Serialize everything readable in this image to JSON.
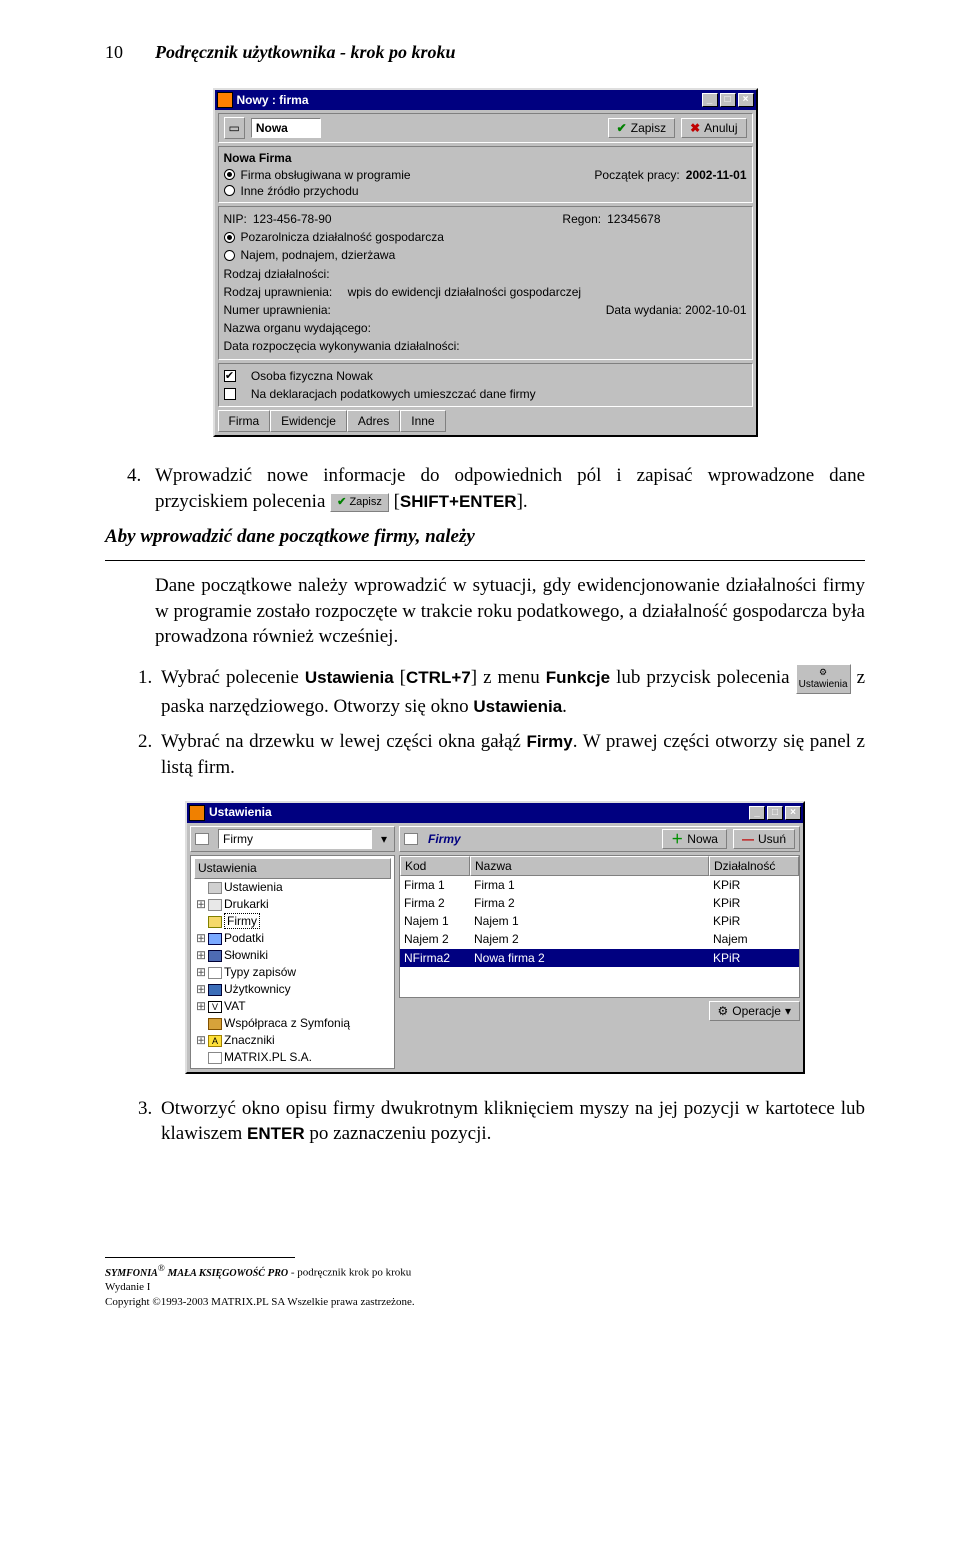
{
  "page": {
    "number": "10",
    "header_title": "Podręcznik użytkownika - krok po kroku"
  },
  "win1": {
    "title": "Nowy : firma",
    "toolbar": {
      "nowa": "Nowa",
      "zapisz": "Zapisz",
      "anuluj": "Anuluj"
    },
    "group1": {
      "heading": "Nowa Firma",
      "opt1": "Firma obsługiwana w programie",
      "opt2": "Inne źródło przychodu",
      "poczatek_label": "Początek pracy:",
      "poczatek_value": "2002-11-01"
    },
    "group2": {
      "nip_label": "NIP:",
      "nip_value": "123-456-78-90",
      "regon_label": "Regon:",
      "regon_value": "12345678",
      "opt1": "Pozarolnicza działalność gospodarcza",
      "opt2": "Najem, podnajem, dzierżawa",
      "f1": "Rodzaj działalności:",
      "f2_label": "Rodzaj uprawnienia:",
      "f2_value": "wpis do ewidencji działalności gospodarczej",
      "f3": "Numer uprawnienia:",
      "f4_label": "Data wydania:",
      "f4_value": "2002-10-01",
      "f5": "Nazwa organu wydającego:",
      "f6": "Data rozpoczęcia wykonywania działalności:"
    },
    "group3": {
      "chk1": "Osoba fizyczna   Nowak",
      "chk2": "Na deklaracjach podatkowych umieszczać dane firmy"
    },
    "tabs": {
      "t1": "Firma",
      "t2": "Ewidencje",
      "t3": "Adres",
      "t4": "Inne"
    }
  },
  "body": {
    "item4_pre": "Wprowadzić nowe informacje do odpowiednich pól i zapisać wprowadzone dane przyciskiem polecenia ",
    "item4_btn": "Zapisz",
    "item4_post": " [",
    "item4_key": "SHIFT+ENTER",
    "item4_end": "].",
    "subhead": "Aby wprowadzić dane początkowe firmy, należy",
    "desc": "Dane początkowe należy wprowadzić w sytuacji, gdy ewidencjonowanie działalności firmy w programie zostało rozpoczęte w trakcie roku podatkowego, a działalność gospodarcza była prowadzona również wcześniej.",
    "li1_pre": "Wybrać polecenie ",
    "li1_b1": "Ustawienia",
    "li1_mid1": " [",
    "li1_key": "CTRL+7",
    "li1_mid2": "] z menu ",
    "li1_b2": "Funkcje",
    "li1_mid3": " lub przycisk polecenia ",
    "li1_btn": "Ustawienia",
    "li1_mid4": " z paska narzędziowego. Otworzy się okno ",
    "li1_b3": "Ustawienia",
    "li1_end": ".",
    "li2_pre": "Wybrać na drzewku w lewej części okna gałąź ",
    "li2_b": "Firmy",
    "li2_post": ". W prawej części otworzy się panel z listą firm."
  },
  "win2": {
    "title": "Ustawienia",
    "dd": "Firmy",
    "panel_title": "Firmy",
    "nowa": "Nowa",
    "usun": "Usuń",
    "operacje": "Operacje",
    "tree_head": "Ustawienia",
    "tree": [
      "Ustawienia",
      "Drukarki",
      "Firmy",
      "Podatki",
      "Słowniki",
      "Typy zapisów",
      "Użytkownicy",
      "VAT",
      "Współpraca z Symfonią",
      "Znaczniki",
      "MATRIX.PL S.A."
    ],
    "cols": {
      "kod": "Kod",
      "nazwa": "Nazwa",
      "dzial": "Działalność"
    },
    "rows": [
      {
        "kod": "Firma 1",
        "nazwa": "Firma 1",
        "dzial": "KPiR"
      },
      {
        "kod": "Firma 2",
        "nazwa": "Firma 2",
        "dzial": "KPiR"
      },
      {
        "kod": "Najem 1",
        "nazwa": "Najem 1",
        "dzial": "KPiR"
      },
      {
        "kod": "Najem 2",
        "nazwa": "Najem 2",
        "dzial": "Najem"
      },
      {
        "kod": "NFirma2",
        "nazwa": "Nowa firma 2",
        "dzial": "KPiR"
      }
    ]
  },
  "item3": {
    "pre": "Otworzyć okno opisu firmy dwukrotnym kliknięciem myszy na jej pozycji w kartotece lub klawiszem ",
    "key": "ENTER",
    "post": " po zaznaczeniu pozycji."
  },
  "footer": {
    "line1_pre": "S",
    "line1_sc": "YMFONIA",
    "line1_reg": "®",
    "line1_mid": " M",
    "line1_sc2": "AŁA ",
    "line1_k": "K",
    "line1_sc3": "SIĘGOWOŚĆ ",
    "line1_p": "P",
    "line1_sc4": "RO",
    "line1_rest": " - podręcznik krok po kroku",
    "line2": "Wydanie I",
    "line3": "Copyright ©1993-2003 MATRIX.PL SA Wszelkie prawa zastrzeżone."
  }
}
